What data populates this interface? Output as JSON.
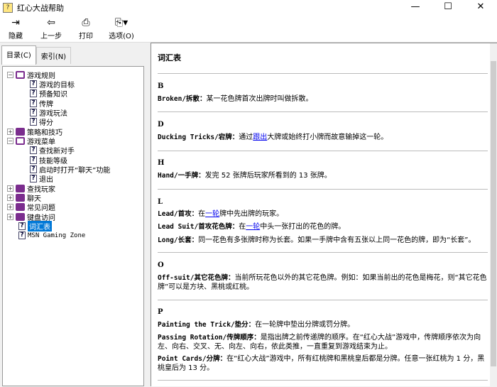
{
  "window": {
    "title": "红心大战帮助",
    "minimize": "—",
    "maximize": "☐",
    "close": "✕"
  },
  "toolbar": {
    "hide": "隐藏",
    "back": "上一步",
    "print": "打印",
    "options": "选项(O)"
  },
  "tabs": {
    "contents": "目录(C)",
    "index": "索引(N)"
  },
  "tree": [
    "游戏规则",
    "游戏的目标",
    "预备知识",
    "传牌",
    "游戏玩法",
    "得分",
    "策略和技巧",
    "游戏菜单",
    "查找新对手",
    "技能等级",
    "启动时打开“聊天”功能",
    "退出",
    "查找玩家",
    "聊天",
    "常见问题",
    "键盘访问",
    "词汇表",
    "MSN Gaming Zone"
  ],
  "content": {
    "title": "词汇表",
    "B": {
      "letter": "B",
      "t1": "Broken/拆散：",
      "d1": "某一花色牌首次出牌时叫做拆散。"
    },
    "D": {
      "letter": "D",
      "t1": "Ducking Tricks/宕牌：",
      "d1a": "通过",
      "l1": "跟出",
      "d1b": "大牌或始终打小牌而故意输掉这一轮。"
    },
    "H": {
      "letter": "H",
      "t1": "Hand/一手牌：",
      "d1": "发完 52 张牌后玩家所看到的 13 张牌。"
    },
    "L": {
      "letter": "L",
      "t1": "Lead/首攻：",
      "d1a": "在",
      "l1": "一轮",
      "d1b": "牌中先出牌的玩家。",
      "t2": "Lead Suit/首攻花色牌：",
      "d2a": "在",
      "l2": "一轮",
      "d2b": "中头一张打出的花色的牌。",
      "t3": "Long/长套：",
      "d3": "同一花色有多张牌时称为长套。如果一手牌中含有五张以上同一花色的牌，即为“长套”。"
    },
    "O": {
      "letter": "O",
      "t1": "Off-suit/其它花色牌：",
      "d1": "当前所玩花色以外的其它花色牌。例如：如果当前出的花色是梅花，则“其它花色牌”可以是方块、黑桃或红桃。"
    },
    "P": {
      "letter": "P",
      "t1": "Painting the Trick/垫分：",
      "d1": "在一轮牌中垫出分牌或罚分牌。",
      "t2": "Passing Rotation/传牌顺序：",
      "d2": "是指出牌之前传递牌的顺序。在“红心大战”游戏中，传牌顺序依次为向左、向右、交叉、无、向左、向右，依此类推，一直重复到游戏结束为止。",
      "t3": "Point Cards/分牌：",
      "d3": "在“红心大战”游戏中，所有红桃牌和黑桃皇后都是分牌。任意一张红桃为 1 分，黑桃皇后为 13 分。"
    }
  }
}
